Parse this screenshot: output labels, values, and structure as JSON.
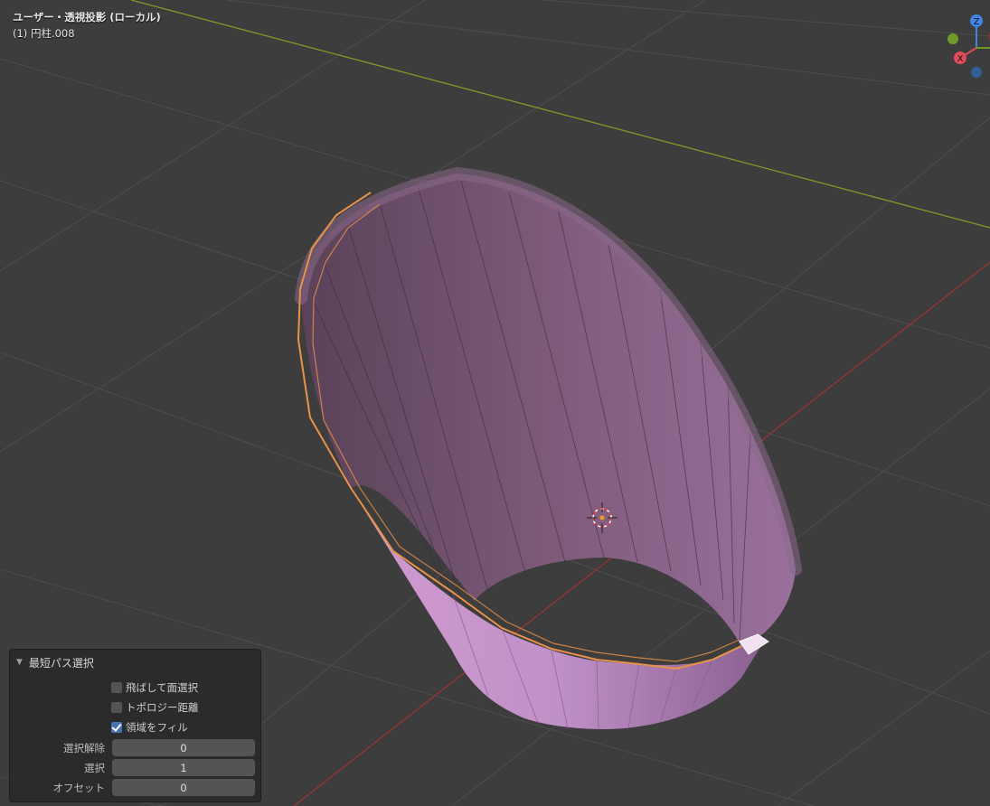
{
  "viewport": {
    "view_mode": "ユーザー・透視投影 (ローカル)",
    "object_name": "(1) 円柱.008",
    "gizmo": {
      "z_label": "Z",
      "x_label": "X"
    }
  },
  "operator_panel": {
    "title": "最短パス選択",
    "options": {
      "face_stepping": {
        "label": "飛ばして面選択",
        "checked": false
      },
      "topology_distance": {
        "label": "トポロジー距離",
        "checked": false
      },
      "fill_region": {
        "label": "領域をフィル",
        "checked": true
      }
    },
    "fields": {
      "deselected": {
        "label": "選択解除",
        "value": "0"
      },
      "selected": {
        "label": "選択",
        "value": "1"
      },
      "offset": {
        "label": "オフセット",
        "value": "0"
      }
    }
  },
  "colors": {
    "background": "#3d3d3d",
    "grid": "#4e4e4e",
    "x_axis": "#9a3535",
    "y_axis": "#7d9a2a",
    "mesh_selected": "#b98ac0",
    "mesh_edge_orange": "#e8924a",
    "gizmo_z": "#3f86e6",
    "gizmo_x": "#e34b5b",
    "gizmo_y": "#6e9a2a"
  }
}
